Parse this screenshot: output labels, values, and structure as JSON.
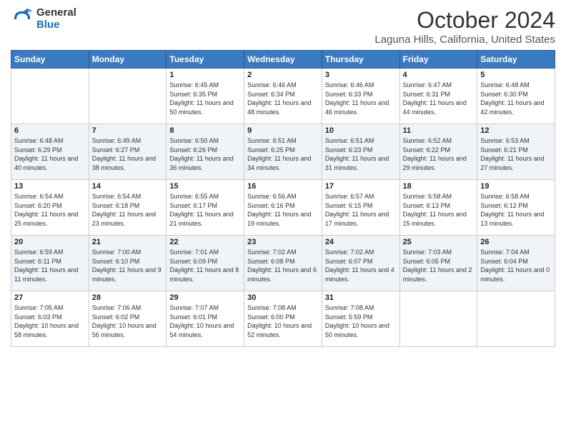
{
  "header": {
    "logo_general": "General",
    "logo_blue": "Blue",
    "month_title": "October 2024",
    "location": "Laguna Hills, California, United States"
  },
  "days_of_week": [
    "Sunday",
    "Monday",
    "Tuesday",
    "Wednesday",
    "Thursday",
    "Friday",
    "Saturday"
  ],
  "weeks": [
    [
      {
        "day": "",
        "info": ""
      },
      {
        "day": "",
        "info": ""
      },
      {
        "day": "1",
        "info": "Sunrise: 6:45 AM\nSunset: 6:35 PM\nDaylight: 11 hours and 50 minutes."
      },
      {
        "day": "2",
        "info": "Sunrise: 6:46 AM\nSunset: 6:34 PM\nDaylight: 11 hours and 48 minutes."
      },
      {
        "day": "3",
        "info": "Sunrise: 6:46 AM\nSunset: 6:33 PM\nDaylight: 11 hours and 46 minutes."
      },
      {
        "day": "4",
        "info": "Sunrise: 6:47 AM\nSunset: 6:31 PM\nDaylight: 11 hours and 44 minutes."
      },
      {
        "day": "5",
        "info": "Sunrise: 6:48 AM\nSunset: 6:30 PM\nDaylight: 11 hours and 42 minutes."
      }
    ],
    [
      {
        "day": "6",
        "info": "Sunrise: 6:48 AM\nSunset: 6:29 PM\nDaylight: 11 hours and 40 minutes."
      },
      {
        "day": "7",
        "info": "Sunrise: 6:49 AM\nSunset: 6:27 PM\nDaylight: 11 hours and 38 minutes."
      },
      {
        "day": "8",
        "info": "Sunrise: 6:50 AM\nSunset: 6:26 PM\nDaylight: 11 hours and 36 minutes."
      },
      {
        "day": "9",
        "info": "Sunrise: 6:51 AM\nSunset: 6:25 PM\nDaylight: 11 hours and 34 minutes."
      },
      {
        "day": "10",
        "info": "Sunrise: 6:51 AM\nSunset: 6:23 PM\nDaylight: 11 hours and 31 minutes."
      },
      {
        "day": "11",
        "info": "Sunrise: 6:52 AM\nSunset: 6:22 PM\nDaylight: 11 hours and 29 minutes."
      },
      {
        "day": "12",
        "info": "Sunrise: 6:53 AM\nSunset: 6:21 PM\nDaylight: 11 hours and 27 minutes."
      }
    ],
    [
      {
        "day": "13",
        "info": "Sunrise: 6:54 AM\nSunset: 6:20 PM\nDaylight: 11 hours and 25 minutes."
      },
      {
        "day": "14",
        "info": "Sunrise: 6:54 AM\nSunset: 6:18 PM\nDaylight: 11 hours and 23 minutes."
      },
      {
        "day": "15",
        "info": "Sunrise: 6:55 AM\nSunset: 6:17 PM\nDaylight: 11 hours and 21 minutes."
      },
      {
        "day": "16",
        "info": "Sunrise: 6:56 AM\nSunset: 6:16 PM\nDaylight: 11 hours and 19 minutes."
      },
      {
        "day": "17",
        "info": "Sunrise: 6:57 AM\nSunset: 6:15 PM\nDaylight: 11 hours and 17 minutes."
      },
      {
        "day": "18",
        "info": "Sunrise: 6:58 AM\nSunset: 6:13 PM\nDaylight: 11 hours and 15 minutes."
      },
      {
        "day": "19",
        "info": "Sunrise: 6:58 AM\nSunset: 6:12 PM\nDaylight: 11 hours and 13 minutes."
      }
    ],
    [
      {
        "day": "20",
        "info": "Sunrise: 6:59 AM\nSunset: 6:11 PM\nDaylight: 11 hours and 11 minutes."
      },
      {
        "day": "21",
        "info": "Sunrise: 7:00 AM\nSunset: 6:10 PM\nDaylight: 11 hours and 9 minutes."
      },
      {
        "day": "22",
        "info": "Sunrise: 7:01 AM\nSunset: 6:09 PM\nDaylight: 11 hours and 8 minutes."
      },
      {
        "day": "23",
        "info": "Sunrise: 7:02 AM\nSunset: 6:08 PM\nDaylight: 11 hours and 6 minutes."
      },
      {
        "day": "24",
        "info": "Sunrise: 7:02 AM\nSunset: 6:07 PM\nDaylight: 11 hours and 4 minutes."
      },
      {
        "day": "25",
        "info": "Sunrise: 7:03 AM\nSunset: 6:05 PM\nDaylight: 11 hours and 2 minutes."
      },
      {
        "day": "26",
        "info": "Sunrise: 7:04 AM\nSunset: 6:04 PM\nDaylight: 11 hours and 0 minutes."
      }
    ],
    [
      {
        "day": "27",
        "info": "Sunrise: 7:05 AM\nSunset: 6:03 PM\nDaylight: 10 hours and 58 minutes."
      },
      {
        "day": "28",
        "info": "Sunrise: 7:06 AM\nSunset: 6:02 PM\nDaylight: 10 hours and 56 minutes."
      },
      {
        "day": "29",
        "info": "Sunrise: 7:07 AM\nSunset: 6:01 PM\nDaylight: 10 hours and 54 minutes."
      },
      {
        "day": "30",
        "info": "Sunrise: 7:08 AM\nSunset: 6:00 PM\nDaylight: 10 hours and 52 minutes."
      },
      {
        "day": "31",
        "info": "Sunrise: 7:08 AM\nSunset: 5:59 PM\nDaylight: 10 hours and 50 minutes."
      },
      {
        "day": "",
        "info": ""
      },
      {
        "day": "",
        "info": ""
      }
    ]
  ]
}
